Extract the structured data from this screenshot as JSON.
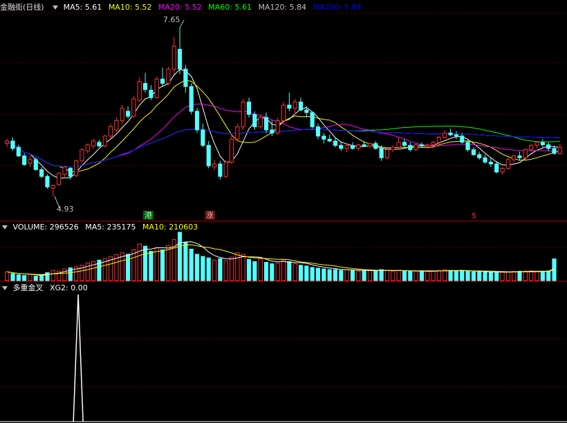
{
  "title": "金融街(日线)",
  "main_legend": [
    {
      "label": "MA5: 5.61",
      "color": "#ffffff"
    },
    {
      "label": "MA10: 5.52",
      "color": "#ffff00"
    },
    {
      "label": "MA20: 5.52",
      "color": "#ff00ff"
    },
    {
      "label": "MA60: 5.61",
      "color": "#00ff00"
    },
    {
      "label": "MA120: 5.84",
      "color": "#c0c0c0"
    },
    {
      "label": "MA250: 5.84",
      "color": "#0000ff"
    }
  ],
  "high_label": "7.65",
  "low_label": "4.93",
  "markers": {
    "gang": "港",
    "zhang": "涨",
    "dollar": "$"
  },
  "volume_legend": {
    "volume": "VOLUME: 296526",
    "ma5": "MA5: 235175",
    "ma10": "MA10: 210603"
  },
  "indicator_legend": {
    "name": "多重金叉",
    "value": "XG2: 0.00"
  },
  "colors": {
    "up": "#ff3232",
    "down": "#54ffff",
    "grid": "#8b0000",
    "bg": "#000000"
  },
  "chart_data": [
    {
      "type": "candlestick",
      "title": "金融街(日线)",
      "ylim": [
        4.75,
        7.85
      ],
      "series": [
        {
          "name": "K",
          "ohlc": [
            [
              5.78,
              5.86,
              5.72,
              5.82
            ],
            [
              5.82,
              5.88,
              5.66,
              5.7
            ],
            [
              5.72,
              5.76,
              5.56,
              5.58
            ],
            [
              5.58,
              5.62,
              5.42,
              5.44
            ],
            [
              5.46,
              5.58,
              5.4,
              5.52
            ],
            [
              5.52,
              5.55,
              5.34,
              5.36
            ],
            [
              5.36,
              5.4,
              5.22,
              5.25
            ],
            [
              5.25,
              5.28,
              5.05,
              5.08
            ],
            [
              5.06,
              5.12,
              4.93,
              5.1
            ],
            [
              5.12,
              5.32,
              5.1,
              5.3
            ],
            [
              5.28,
              5.42,
              5.24,
              5.4
            ],
            [
              5.38,
              5.4,
              5.2,
              5.25
            ],
            [
              5.26,
              5.52,
              5.24,
              5.5
            ],
            [
              5.5,
              5.7,
              5.48,
              5.68
            ],
            [
              5.66,
              5.78,
              5.62,
              5.76
            ],
            [
              5.74,
              5.86,
              5.7,
              5.82
            ],
            [
              5.8,
              5.84,
              5.72,
              5.74
            ],
            [
              5.74,
              5.92,
              5.72,
              5.9
            ],
            [
              5.9,
              6.1,
              5.86,
              6.05
            ],
            [
              6.0,
              6.2,
              5.96,
              6.15
            ],
            [
              6.15,
              6.4,
              6.1,
              6.35
            ],
            [
              6.3,
              6.38,
              6.18,
              6.22
            ],
            [
              6.22,
              6.55,
              6.2,
              6.5
            ],
            [
              6.48,
              6.85,
              6.45,
              6.78
            ],
            [
              6.75,
              6.92,
              6.6,
              6.65
            ],
            [
              6.64,
              6.72,
              6.48,
              6.52
            ],
            [
              6.52,
              6.86,
              6.5,
              6.82
            ],
            [
              6.82,
              7.0,
              6.7,
              6.75
            ],
            [
              6.75,
              7.02,
              6.72,
              6.98
            ],
            [
              6.98,
              7.5,
              6.9,
              7.35
            ],
            [
              7.3,
              7.65,
              6.9,
              6.98
            ],
            [
              6.98,
              7.05,
              6.6,
              6.7
            ],
            [
              6.7,
              6.75,
              6.25,
              6.3
            ],
            [
              6.3,
              6.35,
              5.95,
              6.0
            ],
            [
              6.0,
              6.1,
              5.72,
              5.75
            ],
            [
              5.75,
              5.82,
              5.38,
              5.42
            ],
            [
              5.4,
              5.52,
              5.35,
              5.45
            ],
            [
              5.45,
              5.5,
              5.2,
              5.25
            ],
            [
              5.25,
              5.5,
              5.22,
              5.48
            ],
            [
              5.48,
              5.9,
              5.45,
              5.85
            ],
            [
              5.85,
              6.1,
              5.82,
              6.05
            ],
            [
              6.05,
              6.5,
              6.0,
              6.45
            ],
            [
              6.45,
              6.52,
              6.2,
              6.25
            ],
            [
              6.25,
              6.3,
              6.0,
              6.05
            ],
            [
              6.05,
              6.25,
              6.02,
              6.2
            ],
            [
              6.2,
              6.28,
              5.95,
              6.0
            ],
            [
              6.0,
              6.15,
              5.9,
              5.95
            ],
            [
              5.95,
              6.2,
              5.92,
              6.15
            ],
            [
              6.15,
              6.45,
              6.12,
              6.4
            ],
            [
              6.4,
              6.6,
              6.3,
              6.35
            ],
            [
              6.35,
              6.5,
              6.25,
              6.45
            ],
            [
              6.45,
              6.52,
              6.3,
              6.32
            ],
            [
              6.32,
              6.38,
              6.2,
              6.28
            ],
            [
              6.28,
              6.3,
              6.02,
              6.05
            ],
            [
              6.05,
              6.1,
              5.85,
              5.9
            ],
            [
              5.9,
              5.95,
              5.78,
              5.85
            ],
            [
              5.85,
              5.92,
              5.8,
              5.82
            ],
            [
              5.82,
              5.88,
              5.72,
              5.75
            ],
            [
              5.75,
              5.8,
              5.66,
              5.7
            ],
            [
              5.7,
              5.78,
              5.64,
              5.75
            ],
            [
              5.75,
              5.8,
              5.68,
              5.7
            ],
            [
              5.7,
              5.78,
              5.66,
              5.76
            ],
            [
              5.76,
              5.82,
              5.72,
              5.74
            ],
            [
              5.74,
              5.8,
              5.7,
              5.78
            ],
            [
              5.78,
              5.82,
              5.68,
              5.7
            ],
            [
              5.7,
              5.75,
              5.5,
              5.55
            ],
            [
              5.55,
              5.7,
              5.52,
              5.68
            ],
            [
              5.68,
              5.75,
              5.64,
              5.72
            ],
            [
              5.72,
              5.88,
              5.7,
              5.8
            ],
            [
              5.8,
              5.85,
              5.72,
              5.75
            ],
            [
              5.75,
              5.8,
              5.65,
              5.68
            ],
            [
              5.68,
              5.78,
              5.66,
              5.76
            ],
            [
              5.76,
              5.8,
              5.72,
              5.74
            ],
            [
              5.74,
              5.78,
              5.7,
              5.76
            ],
            [
              5.76,
              5.82,
              5.74,
              5.8
            ],
            [
              5.8,
              5.9,
              5.78,
              5.88
            ],
            [
              5.88,
              6.0,
              5.85,
              5.95
            ],
            [
              5.95,
              6.02,
              5.9,
              5.92
            ],
            [
              5.92,
              5.98,
              5.85,
              5.9
            ],
            [
              5.9,
              5.95,
              5.78,
              5.8
            ],
            [
              5.8,
              5.85,
              5.65,
              5.68
            ],
            [
              5.68,
              5.72,
              5.58,
              5.6
            ],
            [
              5.6,
              5.65,
              5.52,
              5.55
            ],
            [
              5.55,
              5.6,
              5.45,
              5.48
            ],
            [
              5.48,
              5.55,
              5.4,
              5.45
            ],
            [
              5.45,
              5.5,
              5.3,
              5.32
            ],
            [
              5.32,
              5.4,
              5.28,
              5.38
            ],
            [
              5.38,
              5.55,
              5.36,
              5.52
            ],
            [
              5.52,
              5.6,
              5.48,
              5.58
            ],
            [
              5.58,
              5.65,
              5.5,
              5.55
            ],
            [
              5.55,
              5.7,
              5.52,
              5.68
            ],
            [
              5.68,
              5.78,
              5.65,
              5.75
            ],
            [
              5.75,
              5.82,
              5.7,
              5.8
            ],
            [
              5.8,
              5.85,
              5.72,
              5.76
            ],
            [
              5.76,
              5.8,
              5.66,
              5.7
            ],
            [
              5.7,
              5.75,
              5.6,
              5.62
            ],
            [
              5.62,
              5.78,
              5.6,
              5.72
            ]
          ]
        }
      ],
      "moving_averages": [
        "MA5",
        "MA10",
        "MA20",
        "MA60",
        "MA120",
        "MA250"
      ],
      "annotations": [
        {
          "text": "7.65"
        },
        {
          "text": "4.93"
        }
      ]
    },
    {
      "type": "bar",
      "title": "VOLUME",
      "series": [
        {
          "name": "VOLUME",
          "values": [
            120,
            95,
            80,
            70,
            85,
            60,
            75,
            110,
            140,
            130,
            160,
            175,
            190,
            210,
            240,
            260,
            280,
            300,
            330,
            355,
            380,
            360,
            420,
            500,
            470,
            400,
            450,
            420,
            480,
            560,
            660,
            520,
            430,
            360,
            330,
            310,
            280,
            300,
            270,
            320,
            380,
            360,
            290,
            260,
            300,
            250,
            230,
            240,
            280,
            260,
            230,
            210,
            200,
            180,
            170,
            160,
            150,
            150,
            140,
            150,
            140,
            130,
            140,
            135,
            130,
            150,
            140,
            130,
            140,
            130,
            125,
            130,
            128,
            125,
            130,
            140,
            150,
            140,
            130,
            140,
            125,
            120,
            118,
            115,
            110,
            115,
            118,
            120,
            125,
            128,
            130,
            132,
            128,
            125,
            130,
            296.526
          ]
        },
        {
          "name": "MA5",
          "values": []
        },
        {
          "name": "MA10",
          "values": []
        }
      ]
    },
    {
      "type": "line",
      "title": "多重金叉",
      "series": [
        {
          "name": "XG2",
          "spike_index": 12,
          "value": 0.0
        }
      ]
    }
  ]
}
